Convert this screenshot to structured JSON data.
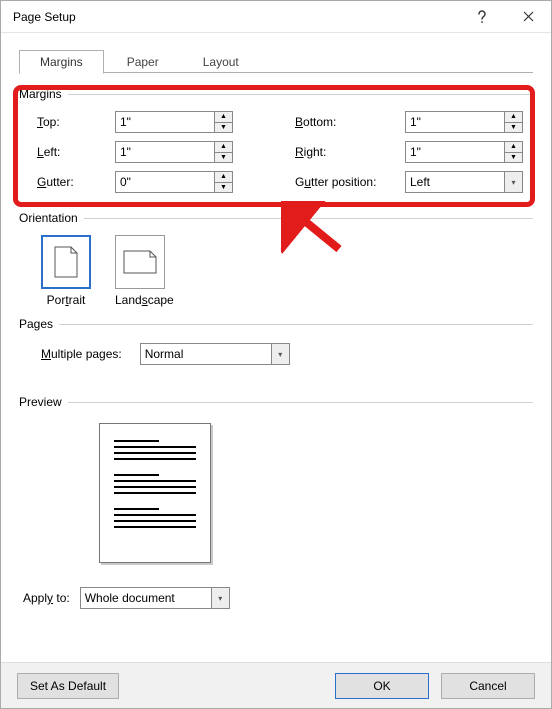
{
  "window": {
    "title": "Page Setup"
  },
  "tabs": {
    "margins": "Margins",
    "paper": "Paper",
    "layout": "Layout"
  },
  "groups": {
    "margins": "Margins",
    "orientation": "Orientation",
    "pages": "Pages",
    "preview": "Preview"
  },
  "margins": {
    "top_label_pre": "",
    "top_label_u": "T",
    "top_label_post": "op:",
    "top_value": "1\"",
    "bottom_label_u": "B",
    "bottom_label_post": "ottom:",
    "bottom_value": "1\"",
    "left_label_u": "L",
    "left_label_post": "eft:",
    "left_value": "1\"",
    "right_label_u": "R",
    "right_label_post": "ight:",
    "right_value": "1\"",
    "gutter_label_u": "G",
    "gutter_label_post": "utter:",
    "gutter_value": "0\"",
    "gutterpos_label_pre": "G",
    "gutterpos_label_u": "u",
    "gutterpos_label_post": "tter position:",
    "gutterpos_value": "Left"
  },
  "orientation": {
    "portrait_pre": "Por",
    "portrait_u": "t",
    "portrait_post": "rait",
    "landscape_pre": "Land",
    "landscape_u": "s",
    "landscape_post": "cape"
  },
  "pages": {
    "multi_label_u": "M",
    "multi_label_post": "ultiple pages:",
    "multi_value": "Normal"
  },
  "apply": {
    "label_pre": "Appl",
    "label_u": "y",
    "label_post": " to:",
    "value": "Whole document"
  },
  "footer": {
    "default": "Set As Default",
    "ok": "OK",
    "cancel": "Cancel"
  }
}
